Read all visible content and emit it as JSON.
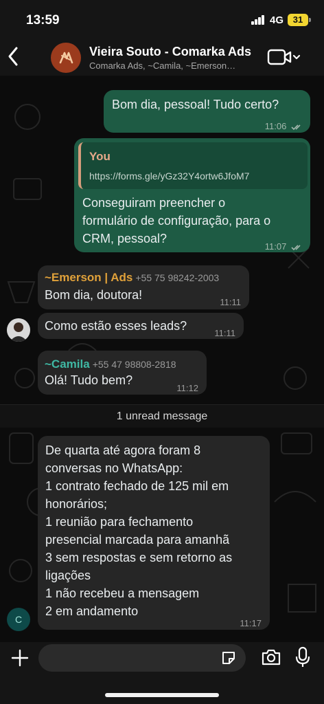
{
  "status": {
    "time": "13:59",
    "network": "4G",
    "battery": "31"
  },
  "header": {
    "title": "Vieira Souto - Comarka Ads",
    "subtitle": "Comarka Ads, ~Camila, ~Emerson…",
    "back_icon": "chevron-left-icon",
    "call_icon": "video-camera-icon"
  },
  "messages": [
    {
      "id": 1,
      "direction": "out",
      "text": "Bom dia, pessoal! Tudo certo?",
      "time": "11:06"
    },
    {
      "id": 2,
      "direction": "out",
      "reply_to": {
        "author": "You",
        "text": "https://forms.gle/yGz32Y4ortw6JfoM7"
      },
      "lines": [
        "Conseguiram preencher o",
        "formulário de configuração, para o",
        "CRM, pessoal?"
      ],
      "time": "11:07"
    },
    {
      "id": 3,
      "direction": "in",
      "sender": "~Emerson | Ads",
      "phone": "+55 75 98242-2003",
      "text": "Bom dia, doutora!",
      "time": "11:11"
    },
    {
      "id": 4,
      "direction": "in",
      "text": "Como estão esses leads?",
      "time": "11:11"
    },
    {
      "id": 5,
      "direction": "in",
      "sender": "~Camila",
      "phone": "+55 47 98808-2818",
      "text": "Olá! Tudo bem?",
      "time": "11:12"
    },
    {
      "id": 6,
      "direction": "in",
      "lines": [
        "De quarta até agora foram 8",
        "conversas no WhatsApp:",
        "1 contrato fechado de 125 mil em",
        "honorários;",
        "1 reunião para fechamento",
        "presencial marcada para amanhã",
        "3 sem respostas e sem retorno as",
        "ligações",
        "1 não recebeu a mensagem",
        "2 em andamento"
      ],
      "time": "11:17",
      "avatar_letter": "C"
    }
  ],
  "unread_divider": "1 unread message",
  "colors": {
    "outgoing": "#1e5b44",
    "incoming": "#262626",
    "emerson": "#e0a13a",
    "camila": "#3fb8a4",
    "quote_bar": "#d59d7c"
  }
}
